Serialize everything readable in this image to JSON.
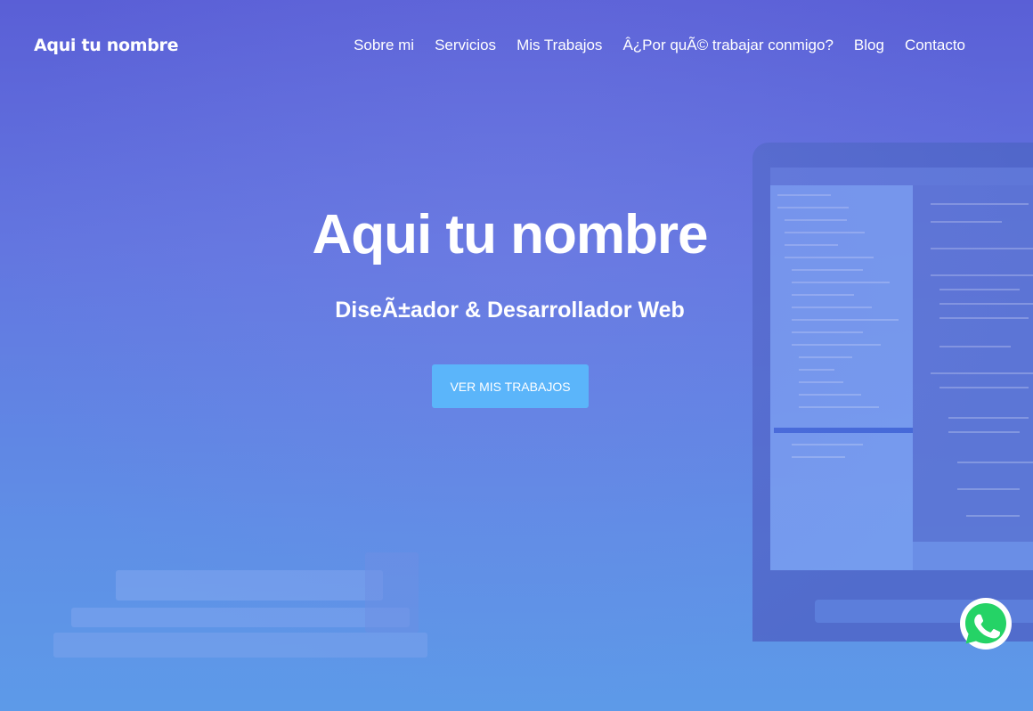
{
  "header": {
    "brand": "Aqui tu nombre",
    "nav": [
      {
        "label": "Sobre mi"
      },
      {
        "label": "Servicios"
      },
      {
        "label": "Mis Trabajos"
      },
      {
        "label": "Â¿Por quÃ© trabajar conmigo?"
      },
      {
        "label": "Blog"
      },
      {
        "label": "Contacto"
      }
    ]
  },
  "hero": {
    "title": "Aqui tu nombre",
    "subtitle": "DiseÃ±ador & Desarrollador Web",
    "button_label": "VER MIS TRABAJOS"
  },
  "floating": {
    "icon": "whatsapp-icon"
  },
  "colors": {
    "accent_button": "#5bb5fa",
    "gradient_top": "#5a5fd6",
    "gradient_bottom": "#5d9ae8",
    "whatsapp_green": "#25d366"
  }
}
